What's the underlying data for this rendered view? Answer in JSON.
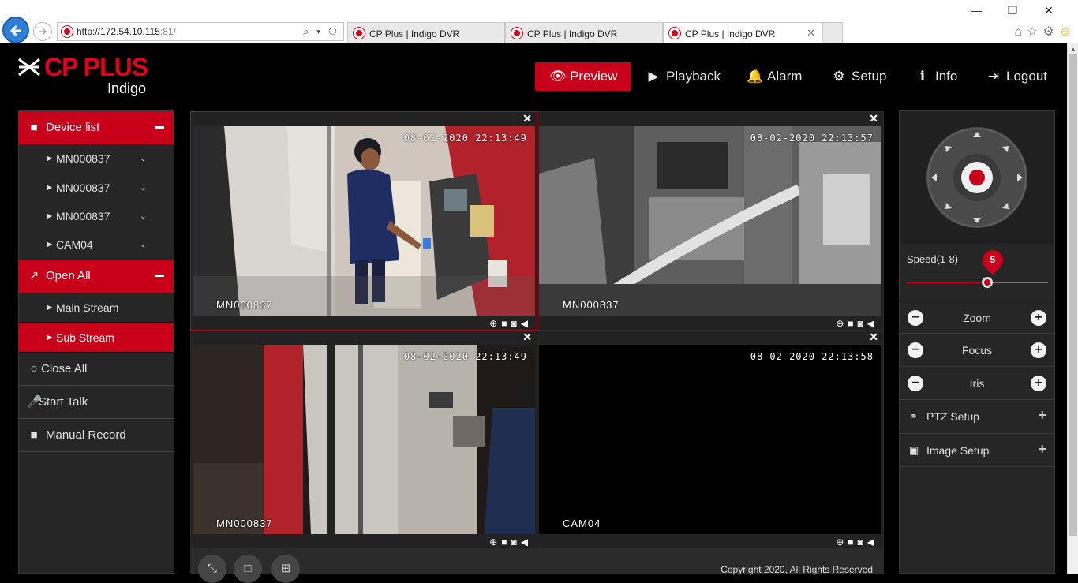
{
  "browser": {
    "url_host": "http://172.54.10.115",
    "url_port": ":81/",
    "url_tools": "⌕ ▾ ↻",
    "tabs": [
      {
        "title": "CP Plus | Indigo DVR"
      },
      {
        "title": "CP Plus | Indigo DVR"
      },
      {
        "title": "CP Plus | Indigo DVR",
        "close": "✕"
      }
    ],
    "window_controls": {
      "minimize": "—",
      "restore": "❐",
      "close": "✕"
    }
  },
  "logo": {
    "brand": "CP PLUS",
    "sub": "Indigo"
  },
  "nav": {
    "preview": "Preview",
    "playback": "Playback",
    "alarm": "Alarm",
    "setup": "Setup",
    "info": "Info",
    "logout": "Logout"
  },
  "sidebar": {
    "device_list": "Device list",
    "devices": [
      "MN000837",
      "MN000837",
      "MN000837",
      "CAM04"
    ],
    "open_all": "Open All",
    "streams": [
      "Main Stream",
      "Sub Stream"
    ],
    "close_all": "Close All",
    "start_talk": "Start Talk",
    "manual_record": "Manual Record"
  },
  "cells": [
    {
      "timestamp": "08-02-2020 22:13:49",
      "name": "MN000837"
    },
    {
      "timestamp": "08-02-2020 22:13:57",
      "name": "MN000837"
    },
    {
      "timestamp": "08-02-2020 22:13:49",
      "name": "MN000837"
    },
    {
      "timestamp": "08-02-2020 22:13:58",
      "name": "CAM04"
    }
  ],
  "footer": {
    "copyright": "Copyright 2020, All Rights Reserved"
  },
  "ptz": {
    "speed_label": "Speed(1-8)",
    "speed_value": "5",
    "speed_min": 1,
    "speed_max": 8,
    "zoom": "Zoom",
    "focus": "Focus",
    "iris": "Iris",
    "ptz_setup": "PTZ Setup",
    "image_setup": "Image Setup"
  },
  "colors": {
    "accent": "#c8001a",
    "panel": "#262626"
  }
}
